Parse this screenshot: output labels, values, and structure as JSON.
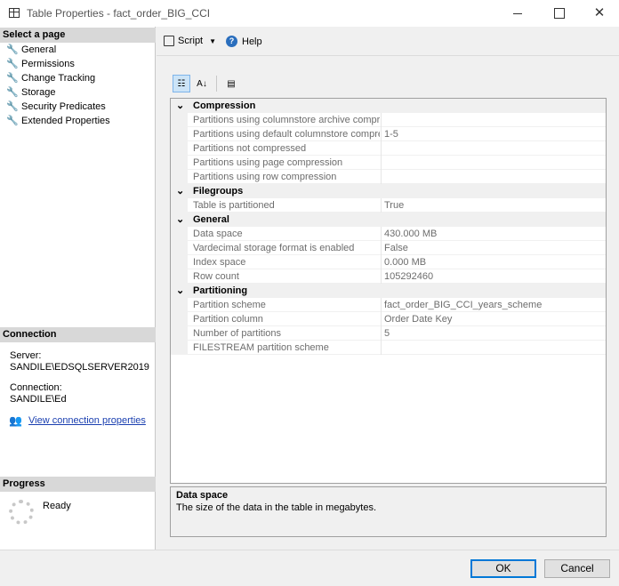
{
  "window": {
    "title": "Table Properties - fact_order_BIG_CCI",
    "close_glyph": "✕"
  },
  "sidebar": {
    "select_header": "Select a page",
    "pages": [
      {
        "label": "General"
      },
      {
        "label": "Permissions"
      },
      {
        "label": "Change Tracking"
      },
      {
        "label": "Storage"
      },
      {
        "label": "Security Predicates"
      },
      {
        "label": "Extended Properties"
      }
    ],
    "connection_header": "Connection",
    "server_label": "Server:",
    "server_value": "SANDILE\\EDSQLSERVER2019",
    "connection_label": "Connection:",
    "connection_value": "SANDILE\\Ed",
    "view_link": "View connection properties",
    "progress_header": "Progress",
    "progress_status": "Ready"
  },
  "toolbar": {
    "script_label": "Script",
    "help_label": "Help"
  },
  "grid": {
    "categories": [
      {
        "name": "Compression",
        "props": [
          {
            "name": "Partitions using columnstore archive compres",
            "value": ""
          },
          {
            "name": "Partitions using default columnstore compres",
            "value": "1-5"
          },
          {
            "name": "Partitions not compressed",
            "value": ""
          },
          {
            "name": "Partitions using page compression",
            "value": ""
          },
          {
            "name": "Partitions using row compression",
            "value": ""
          }
        ]
      },
      {
        "name": "Filegroups",
        "props": [
          {
            "name": "Table is partitioned",
            "value": "True"
          }
        ]
      },
      {
        "name": "General",
        "props": [
          {
            "name": "Data space",
            "value": "430.000 MB"
          },
          {
            "name": "Vardecimal storage format is enabled",
            "value": "False"
          },
          {
            "name": "Index space",
            "value": "0.000 MB"
          },
          {
            "name": "Row count",
            "value": "105292460"
          }
        ]
      },
      {
        "name": "Partitioning",
        "props": [
          {
            "name": "Partition scheme",
            "value": "fact_order_BIG_CCI_years_scheme"
          },
          {
            "name": "Partition column",
            "value": "Order Date Key"
          },
          {
            "name": "Number of partitions",
            "value": "5"
          },
          {
            "name": "FILESTREAM partition scheme",
            "value": ""
          }
        ]
      }
    ]
  },
  "description": {
    "title": "Data space",
    "text": "The size of the data in the table in megabytes."
  },
  "footer": {
    "ok_label": "OK",
    "cancel_label": "Cancel"
  }
}
